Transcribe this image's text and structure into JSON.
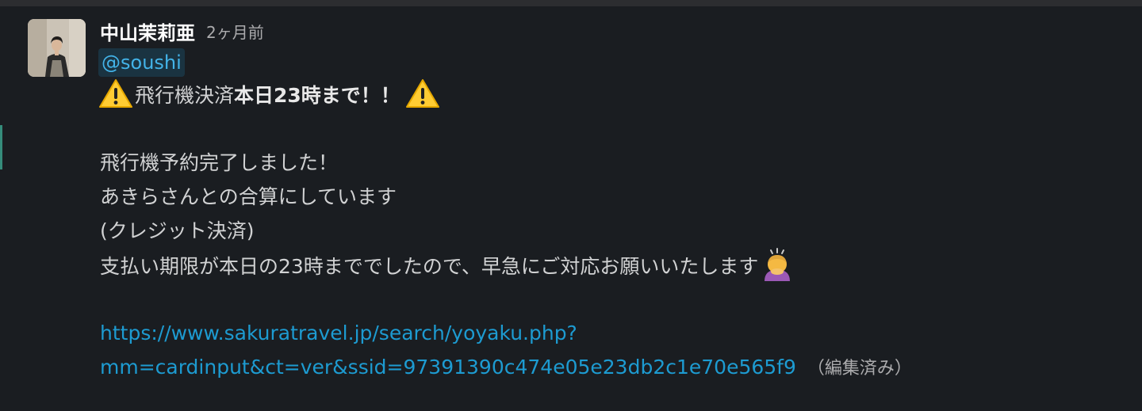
{
  "message": {
    "author": "中山茉莉亜",
    "timestamp": "2ヶ月前",
    "mention": "@soushi",
    "headline": {
      "normal": "飛行機決済",
      "bold": "本日23時まで！！"
    },
    "lines": [
      "飛行機予約完了しました！",
      "あきらさんとの合算にしています",
      "(クレジット決済)",
      "支払い期限が本日の23時まででしたので、早急にご対応お願いいたします"
    ],
    "link_part1": "https://www.sakuratravel.jp/search/yoyaku.php?",
    "link_part2": "mm=cardinput&ct=ver&ssid=97391390c474e05e23db2c1e70e565f9",
    "edited_label": "（編集済み）"
  },
  "icons": {
    "warning": "warning-icon",
    "bow": "person-bowing-icon"
  },
  "colors": {
    "background": "#1a1d21",
    "text": "#d1d2d3",
    "link": "#1d9bd1",
    "mention": "#43b3e8",
    "author": "#ffffff",
    "muted": "#ababad"
  }
}
